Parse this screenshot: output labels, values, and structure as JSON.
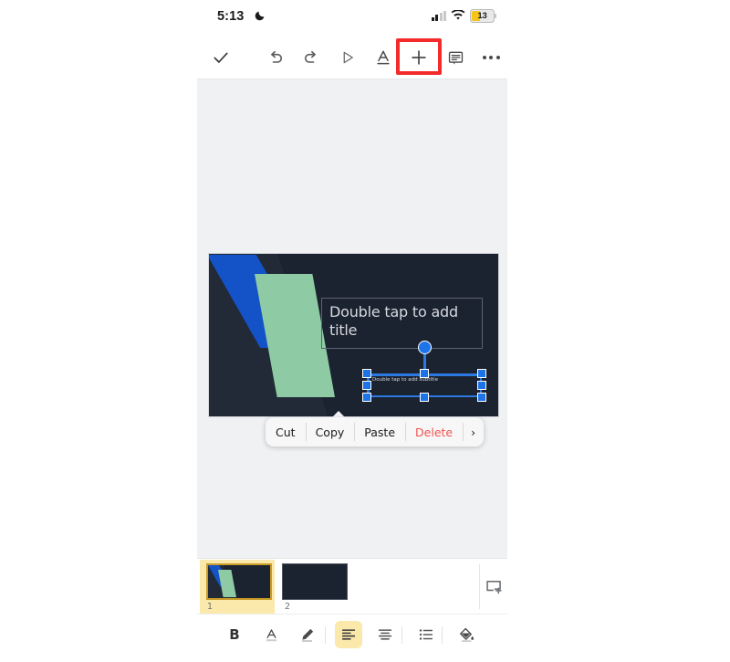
{
  "status_bar": {
    "time": "5:13",
    "dnd_icon": "crescent-moon-icon",
    "signal_icon": "cellular-signal-icon",
    "wifi_icon": "wifi-icon",
    "battery_level": "13",
    "battery_color": "#f5c518"
  },
  "toolbar": {
    "done_label": "done-checkmark",
    "undo_label": "undo",
    "redo_label": "redo",
    "present_label": "present",
    "format_label": "text-format",
    "insert_label": "insert",
    "comment_label": "comment",
    "more_label": "more-options",
    "highlight_color": "#f42b2b",
    "highlighted_item": "insert"
  },
  "canvas": {
    "background_color": "#eff1f3",
    "slide": {
      "background_color": "#1b2230",
      "shape_blue_color": "#1452c8",
      "shape_green_color": "#8ecba4",
      "title_placeholder": "Double tap to add title",
      "subtitle_placeholder": "Double tap to add subtitle",
      "selection_color": "#1d74e8"
    }
  },
  "context_menu": {
    "items": [
      {
        "label": "Cut",
        "danger": false
      },
      {
        "label": "Copy",
        "danger": false
      },
      {
        "label": "Paste",
        "danger": false
      },
      {
        "label": "Delete",
        "danger": true
      }
    ],
    "more_arrow": "›",
    "danger_color": "#f0534e"
  },
  "filmstrip": {
    "slides": [
      {
        "number": "1",
        "selected": true
      },
      {
        "number": "2",
        "selected": false
      }
    ],
    "selected_color": "#fbe9ab",
    "add_slide_label": "add-slide"
  },
  "bottom_toolbar": {
    "bold_label": "B",
    "text_color_label": "text-color",
    "highlighter_label": "highlighter",
    "align_left_label": "align-left",
    "align_center_label": "align-center",
    "bulleted_list_label": "bulleted-list",
    "fill_color_label": "fill-color",
    "active_item": "align-left",
    "active_color": "#fbe9ab"
  }
}
